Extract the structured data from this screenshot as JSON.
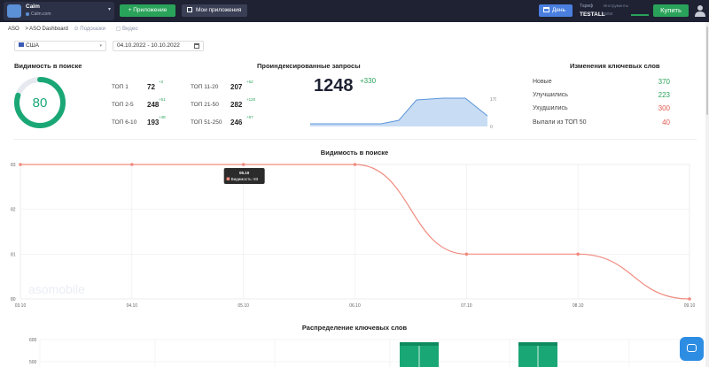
{
  "topbar": {
    "app_name": "Calm",
    "app_subtitle": "Calm.com",
    "add_app_label": "+ Приложение",
    "my_apps_label": "Мои приложения",
    "period_label": "День",
    "tariff_label": "Тариф",
    "tariff_name": "TESTALL",
    "tools_label": "Инструменты",
    "tools_value": "45/50",
    "buy_label": "Купить"
  },
  "breadcrumb": {
    "root": "ASO",
    "current": "> ASO Dashboard",
    "help": "Подсказки",
    "video": "Видео"
  },
  "filters": {
    "country": "США",
    "date_range": "04.10.2022 - 10.10.2022"
  },
  "visibility": {
    "title": "Видимость в поиске",
    "score": "80",
    "score_fraction": 0.8,
    "tops": [
      {
        "label": "ТОП 1",
        "value": "72",
        "delta": "+2"
      },
      {
        "label": "ТОП 2-5",
        "value": "248",
        "delta": "+51"
      },
      {
        "label": "ТОП 6-10",
        "value": "193",
        "delta": "+48"
      },
      {
        "label": "ТОП 11-20",
        "value": "207",
        "delta": "+52"
      },
      {
        "label": "ТОП 21-50",
        "value": "282",
        "delta": "+120"
      },
      {
        "label": "ТОП 51-250",
        "value": "246",
        "delta": "+57"
      }
    ]
  },
  "indexed": {
    "title": "Проиндексированные запросы",
    "value": "1248",
    "delta": "+330",
    "axis_top": "1700",
    "axis_bottom": "0"
  },
  "keyword_changes": {
    "title": "Изменения ключевых слов",
    "items": [
      {
        "label": "Новые",
        "value": "370",
        "color": "green"
      },
      {
        "label": "Улучшились",
        "value": "223",
        "color": "green"
      },
      {
        "label": "Ухудшились",
        "value": "300",
        "color": "red"
      },
      {
        "label": "Выпали из ТОП 50",
        "value": "40",
        "color": "red"
      }
    ]
  },
  "chart_data": [
    {
      "type": "line",
      "title": "Видимость в поиске",
      "x": [
        "03.10",
        "04.10",
        "05.10",
        "06.10",
        "07.10",
        "08.10",
        "09.10"
      ],
      "series": [
        {
          "name": "Видимость",
          "values": [
            83,
            83,
            83,
            83,
            81,
            81,
            80
          ],
          "color": "#f08a7e"
        }
      ],
      "ylim": [
        80,
        83
      ],
      "yticks": [
        "83",
        "82",
        "81",
        "80"
      ],
      "grid": true,
      "tooltip": {
        "title": "05.10",
        "text": "Видимость: 83"
      },
      "watermark": "asomobile"
    },
    {
      "type": "bar",
      "title": "Распределение ключевых слов",
      "yticks": [
        "600",
        "500"
      ],
      "color": "#1aa776"
    }
  ],
  "distribution": {
    "title": "Распределение ключевых слов"
  }
}
